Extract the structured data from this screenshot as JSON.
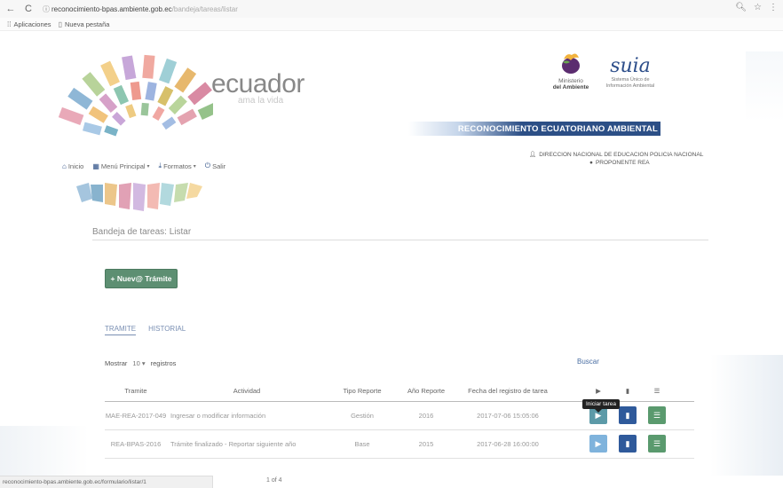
{
  "browser": {
    "url_host": "reconocimiento-bpas.ambiente.gob.ec",
    "url_path": "/bandeja/tareas/listar",
    "bookmarks": [
      {
        "label": "Aplicaciones",
        "icon": "apps-grid-icon"
      },
      {
        "label": "Nueva pestaña",
        "icon": "page-icon"
      }
    ]
  },
  "header": {
    "brand_name": "ecuador",
    "brand_tagline": "ama la vida",
    "ministry_line1": "Ministerio",
    "ministry_line2": "del Ambiente",
    "suia_logo": "suia",
    "suia_sub1": "Sistema Único de",
    "suia_sub2": "Información Ambiental",
    "banner": "RECONOCIMIENTO ECUATORIANO AMBIENTAL",
    "institution": "DIRECCION NACIONAL DE EDUCACION POLICIA NACIONAL",
    "role": "PROPONENTE REA"
  },
  "menu": {
    "inicio": "Inicio",
    "menu_principal": "Menú Principal",
    "formatos": "Formatos",
    "salir": "Salir"
  },
  "breadcrumb": "Bandeja de tareas: Listar",
  "new_button": "+ Nuev@ Trámite",
  "tabs": [
    "TRAMITE",
    "HISTORIAL"
  ],
  "length": {
    "prefix": "Mostrar",
    "value": "10",
    "suffix": "registros"
  },
  "search_label": "Buscar",
  "table": {
    "headers": [
      "Tramite",
      "Actividad",
      "Tipo Reporte",
      "Año Reporte",
      "Fecha del registro de tarea"
    ],
    "rows": [
      {
        "tramite": "MAE-REA-2017-049",
        "actividad": "Ingresar o modificar información",
        "tipo": "Gestión",
        "anio": "2016",
        "fecha": "2017-07-06 15:05:06"
      },
      {
        "tramite": "REA-BPAS-2016",
        "actividad": "Trámite finalizado - Reportar siguiente año",
        "tipo": "Base",
        "anio": "2015",
        "fecha": "2017-06-28 16:00:00"
      }
    ]
  },
  "tooltip": "Iniciar tarea",
  "status_url": "reconocimiento-bpas.ambiente.gob.ec/formulario/listar/1",
  "page_info": "1 of 4",
  "colors": {
    "primary": "#2c4f86",
    "success": "#5d8f72"
  }
}
